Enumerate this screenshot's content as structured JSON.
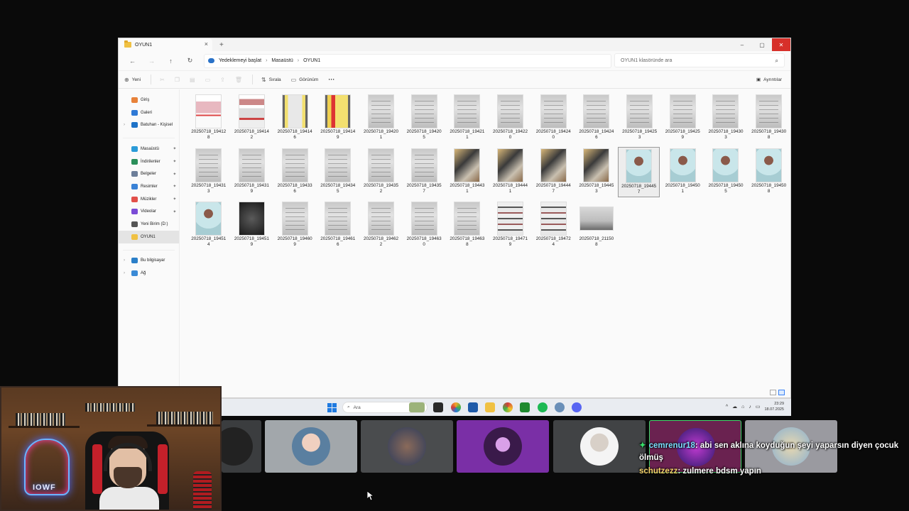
{
  "window": {
    "tab_title": "OYUN1",
    "new_tab": "+",
    "close_tab": "×",
    "controls": {
      "minimize": "–",
      "maximize": "▢",
      "close": "✕"
    }
  },
  "navigation": {
    "back": "←",
    "forward": "→",
    "up": "↑",
    "refresh": "↻",
    "breadcrumb": [
      "Yedeklemeyi başlat",
      "Masaüstü",
      "OYUN1"
    ],
    "breadcrumb_sep": "›",
    "search_placeholder": "OYUN1 klasöründe ara"
  },
  "commands": {
    "new": "Yeni",
    "sort": "Sırala",
    "view": "Görünüm",
    "more": "···",
    "details": "Ayrıntılar"
  },
  "sidebar": {
    "items": [
      {
        "label": "Giriş",
        "color": "#e8823a"
      },
      {
        "label": "Galeri",
        "color": "#2f7ad6"
      },
      {
        "label": "Batuhan - Kişisel",
        "color": "#1e73c8"
      },
      {
        "label": "Masaüstü",
        "color": "#2b9bd8"
      },
      {
        "label": "İndirilenler",
        "color": "#2a8f5a"
      },
      {
        "label": "Belgeler",
        "color": "#6d7f9a"
      },
      {
        "label": "Resimler",
        "color": "#3a82d6"
      },
      {
        "label": "Müzikler",
        "color": "#e2504a"
      },
      {
        "label": "Videolar",
        "color": "#7a4bd6"
      },
      {
        "label": "Yeni Birim (D:)",
        "color": "#555555"
      },
      {
        "label": "OYUN1",
        "color": "#f0c143"
      },
      {
        "label": "Bu bilgisayar",
        "color": "#2b7fc8"
      },
      {
        "label": "Ağ",
        "color": "#3a8ad6"
      }
    ],
    "pin": "📌"
  },
  "files": [
    {
      "name": "20250718_19412\n8",
      "kind": "poster-red"
    },
    {
      "name": "20250718_19414\n2",
      "kind": "poster-red2"
    },
    {
      "name": "20250718_19414\n6",
      "kind": "poster-yellow"
    },
    {
      "name": "20250718_19414\n9",
      "kind": "poster-yellow2"
    },
    {
      "name": "20250718_19420\n1",
      "kind": "doc"
    },
    {
      "name": "20250718_19420\n5",
      "kind": "doc"
    },
    {
      "name": "20250718_19421\n1",
      "kind": "doc"
    },
    {
      "name": "20250718_19422\n0",
      "kind": "doc"
    },
    {
      "name": "20250718_19424\n0",
      "kind": "doc"
    },
    {
      "name": "20250718_19424\n6",
      "kind": "doc"
    },
    {
      "name": "20250718_19425\n3",
      "kind": "doc"
    },
    {
      "name": "20250718_19425\n9",
      "kind": "doc"
    },
    {
      "name": "20250718_19430\n3",
      "kind": "doc"
    },
    {
      "name": "20250718_19430\n8",
      "kind": "doc"
    },
    {
      "name": "20250718_19431\n3",
      "kind": "doc"
    },
    {
      "name": "20250718_19431\n9",
      "kind": "doc"
    },
    {
      "name": "20250718_19433\n6",
      "kind": "doc"
    },
    {
      "name": "20250718_19434\n5",
      "kind": "doc"
    },
    {
      "name": "20250718_19435\n2",
      "kind": "doc"
    },
    {
      "name": "20250718_19435\n7",
      "kind": "doc"
    },
    {
      "name": "20250718_19443\n1",
      "kind": "photo"
    },
    {
      "name": "20250718_19444\n1",
      "kind": "photo"
    },
    {
      "name": "20250718_19444\n7",
      "kind": "photo"
    },
    {
      "name": "20250718_19445\n3",
      "kind": "photo"
    },
    {
      "name": "20250718_19445\n7",
      "kind": "id",
      "selected": true
    },
    {
      "name": "20250718_19450\n1",
      "kind": "id"
    },
    {
      "name": "20250718_19450\n5",
      "kind": "id"
    },
    {
      "name": "20250718_19450\n8",
      "kind": "id"
    },
    {
      "name": "20250718_19451\n4",
      "kind": "id"
    },
    {
      "name": "20250718_19451\n9",
      "kind": "dark"
    },
    {
      "name": "20250718_19460\n9",
      "kind": "doc"
    },
    {
      "name": "20250718_19461\n6",
      "kind": "doc"
    },
    {
      "name": "20250718_19462\n2",
      "kind": "doc"
    },
    {
      "name": "20250718_19463\n0",
      "kind": "doc"
    },
    {
      "name": "20250718_19463\n8",
      "kind": "doc"
    },
    {
      "name": "20250718_19471\n9",
      "kind": "collage"
    },
    {
      "name": "20250718_19472\n4",
      "kind": "collage"
    },
    {
      "name": "20250718_21150\n8",
      "kind": "land"
    }
  ],
  "taskbar": {
    "search_label": "Ara",
    "time": "23:29",
    "date": "18.07.2025",
    "tray_chevron": "^"
  },
  "chat": [
    {
      "user": "cemrenur18",
      "message": ": abi sen aklına koyduğun şeyi yaparsın diyen çocuk ölmüş"
    },
    {
      "user": "schutzezz",
      "message": ": zulmere bdsm yapın"
    }
  ],
  "webcam": {
    "neon_text": "IOWF"
  }
}
